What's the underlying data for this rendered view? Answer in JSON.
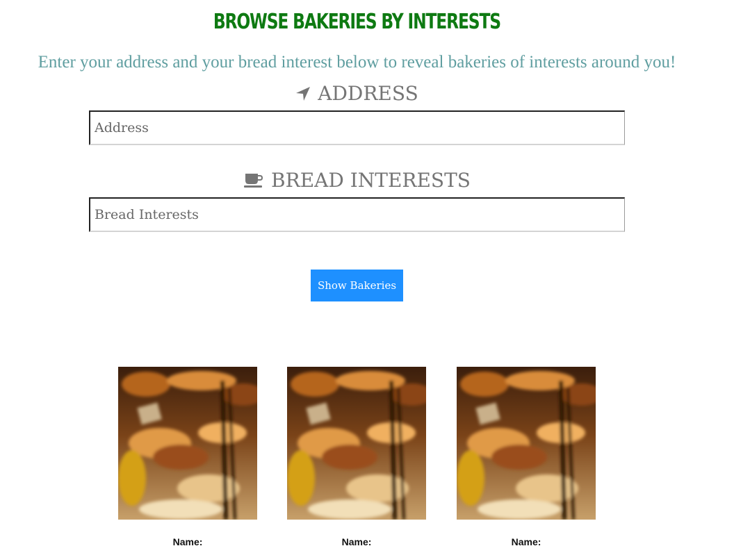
{
  "page": {
    "title": "BROWSE BAKERIES BY INTERESTS",
    "intro": "Enter your address and your bread interest below to reveal bakeries of interests around you!"
  },
  "form": {
    "address_label": "ADDRESS",
    "address_icon": "location-arrow-icon",
    "address_placeholder": "Address",
    "address_value": "",
    "bread_label": "BREAD INTERESTS",
    "bread_icon": "coffee-cup-icon",
    "bread_placeholder": "Bread Interests",
    "bread_value": "",
    "submit_label": "Show Bakeries"
  },
  "results": [
    {
      "name_label": "Name:",
      "image": "bakery-display-photo"
    },
    {
      "name_label": "Name:",
      "image": "bakery-display-photo"
    },
    {
      "name_label": "Name:",
      "image": "bakery-display-photo"
    }
  ],
  "colors": {
    "title": "#0e7a12",
    "intro": "#5f9ea0",
    "label": "#757575",
    "button": "#1e90ff"
  }
}
